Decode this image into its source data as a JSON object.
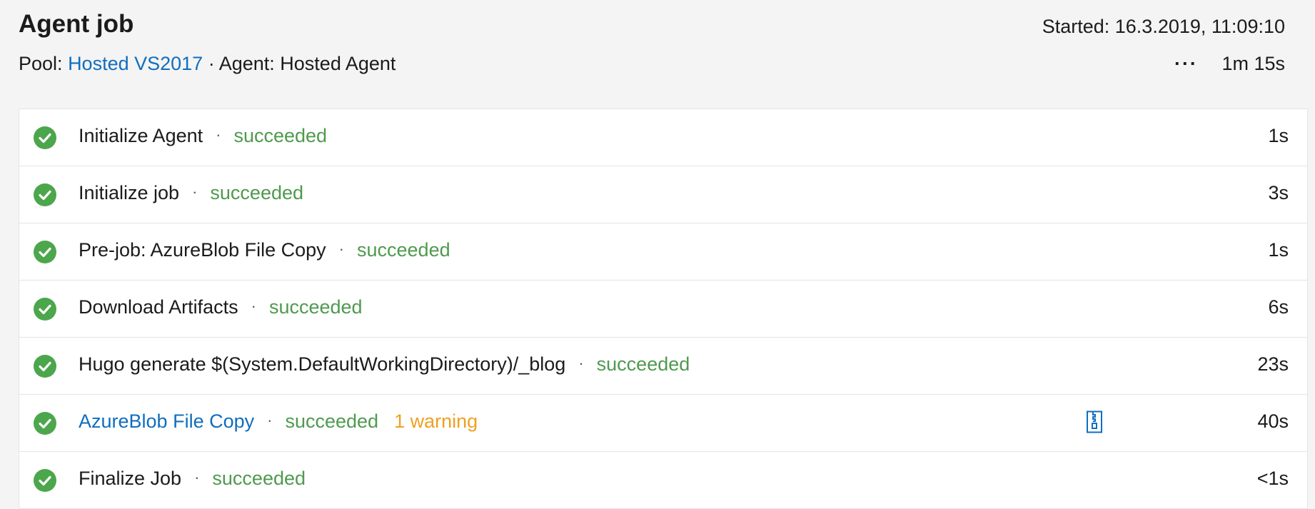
{
  "header": {
    "title": "Agent job",
    "started": "Started: 16.3.2019, 11:09:10",
    "pool_label": "Pool:",
    "pool_name": "Hosted VS2017",
    "separator": "·",
    "agent_text": "Agent: Hosted Agent",
    "more_label": "···",
    "total_duration": "1m 15s"
  },
  "colors": {
    "success": "#4ca64c",
    "link": "#106ebe",
    "warning": "#f0a020"
  },
  "steps": [
    {
      "name": "Initialize Agent",
      "status": "succeeded",
      "duration": "1s"
    },
    {
      "name": "Initialize job",
      "status": "succeeded",
      "duration": "3s"
    },
    {
      "name": "Pre-job: AzureBlob File Copy",
      "status": "succeeded",
      "duration": "1s"
    },
    {
      "name": "Download Artifacts",
      "status": "succeeded",
      "duration": "6s"
    },
    {
      "name": "Hugo generate $(System.DefaultWorkingDirectory)/_blog",
      "status": "succeeded",
      "duration": "23s"
    },
    {
      "name": "AzureBlob File Copy",
      "status": "succeeded",
      "warning": "1 warning",
      "duration": "40s",
      "icon": "zip-file-icon"
    },
    {
      "name": "Finalize Job",
      "status": "succeeded",
      "duration": "<1s"
    }
  ]
}
